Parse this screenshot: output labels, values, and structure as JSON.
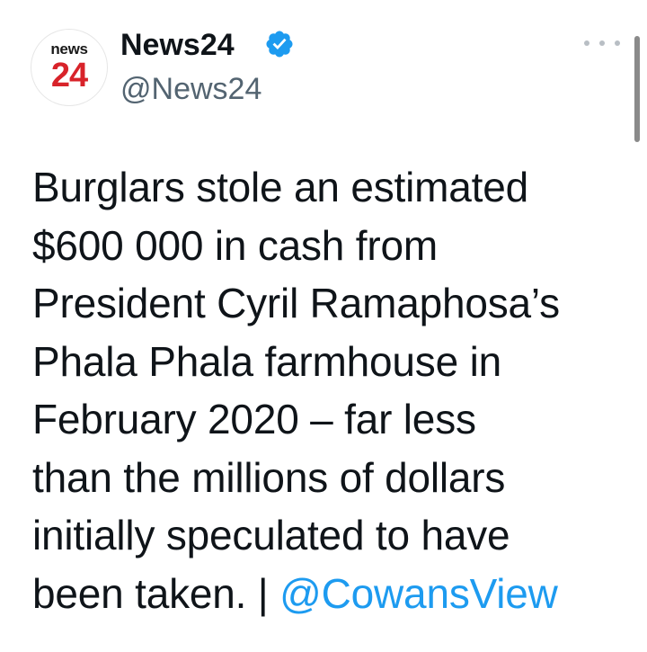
{
  "author": {
    "avatar_top_text": "news",
    "avatar_bottom_text": "24",
    "display_name": "News24",
    "handle": "@News24",
    "verified_icon": "verified-badge-icon"
  },
  "menu": {
    "more_icon": "more-options-icon"
  },
  "tweet": {
    "text": "Burglars stole an estimated\n$600 000 in cash from\nPresident Cyril Ramaphosa’s\nPhala Phala farmhouse in\nFebruary 2020 – far less\nthan the millions of dollars\ninitially speculated to have\nbeen taken. | ",
    "mention": "@CowansView"
  },
  "colors": {
    "text": "#0f1419",
    "secondary": "#536471",
    "link": "#1d9bf0",
    "verified": "#1d9bf0",
    "brand_red": "#d8232a"
  }
}
